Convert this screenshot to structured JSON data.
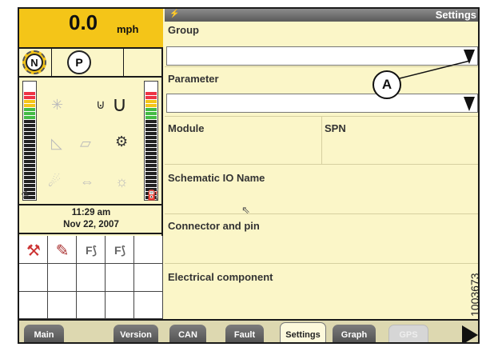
{
  "status": {
    "speed_value": "0.0",
    "speed_unit": "mph",
    "gear": "N",
    "park": "P",
    "time": "11:29 am",
    "date": "Nov 22, 2007"
  },
  "header": {
    "title": "Settings"
  },
  "fields": {
    "group_label": "Group",
    "group_value": "",
    "parameter_label": "Parameter",
    "parameter_value": "",
    "module_label": "Module",
    "spn_label": "SPN",
    "schematic_label": "Schematic IO Name",
    "connector_label": "Connector and pin",
    "electrical_label": "Electrical component"
  },
  "tabs": [
    {
      "label": "Main"
    },
    {
      "label": "Version"
    },
    {
      "label": "CAN"
    },
    {
      "label": "Fault"
    },
    {
      "label": "Settings"
    },
    {
      "label": "Graph"
    },
    {
      "label": "GPS"
    }
  ],
  "annotation": {
    "callout": "A",
    "figure_id": "1003673"
  },
  "icons": {
    "gear": "neutral-gear-icon",
    "park": "park-brake-icon",
    "next": "next-page-arrow-icon"
  },
  "colors": {
    "status_yellow": "#f4c518",
    "panel_bg": "#fbf6c8",
    "tab_dark": "#5a5a5a"
  }
}
